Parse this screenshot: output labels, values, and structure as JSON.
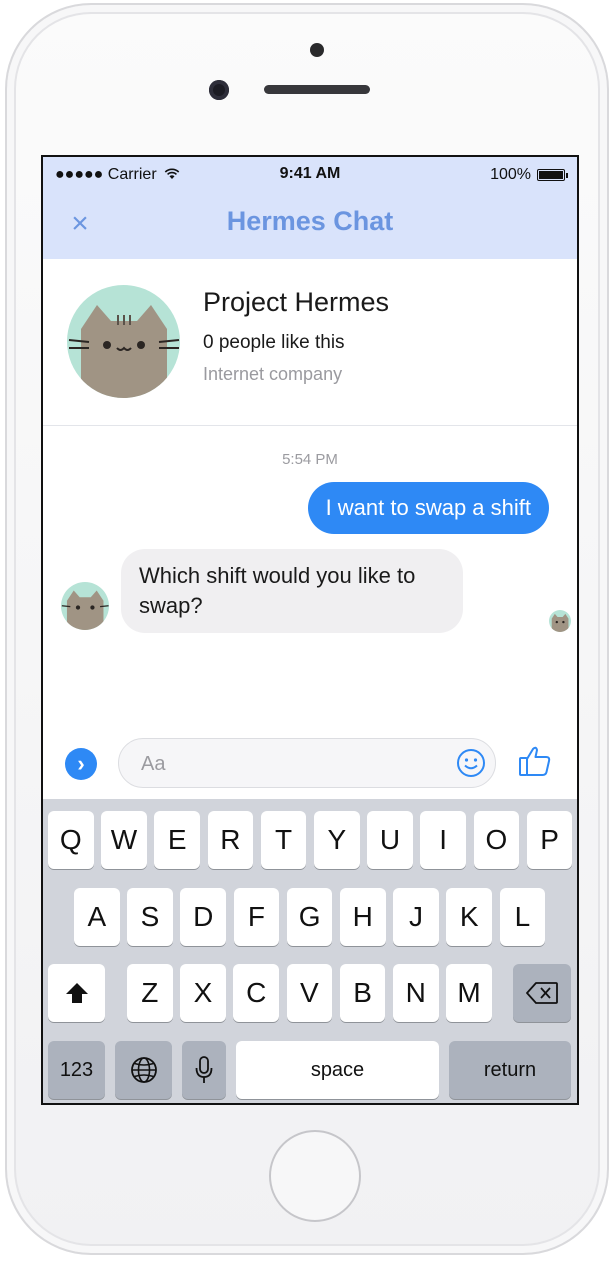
{
  "status_bar": {
    "carrier": "●●●●● Carrier",
    "time": "9:41 AM",
    "battery": "100%"
  },
  "header": {
    "title": "Hermes Chat",
    "close_icon": "×"
  },
  "profile": {
    "name": "Project Hermes",
    "likes": "0 people like this",
    "category": "Internet company"
  },
  "conversation": {
    "timestamp": "5:54 PM",
    "outgoing": "I want to swap a shift",
    "incoming": "Which shift would you like to swap?"
  },
  "composer": {
    "placeholder": "Aa",
    "more_icon": "›"
  },
  "keyboard": {
    "row1": [
      "Q",
      "W",
      "E",
      "R",
      "T",
      "Y",
      "U",
      "I",
      "O",
      "P"
    ],
    "row2": [
      "A",
      "S",
      "D",
      "F",
      "G",
      "H",
      "J",
      "K",
      "L"
    ],
    "row3": [
      "Z",
      "X",
      "C",
      "V",
      "B",
      "N",
      "M"
    ],
    "numbers": "123",
    "space": "space",
    "return": "return"
  },
  "colors": {
    "accent": "#2e89f5",
    "header_bg": "#d9e3fb",
    "title": "#6b95e0",
    "avatar_bg": "#b6e3d6",
    "cat_body": "#a09484"
  }
}
